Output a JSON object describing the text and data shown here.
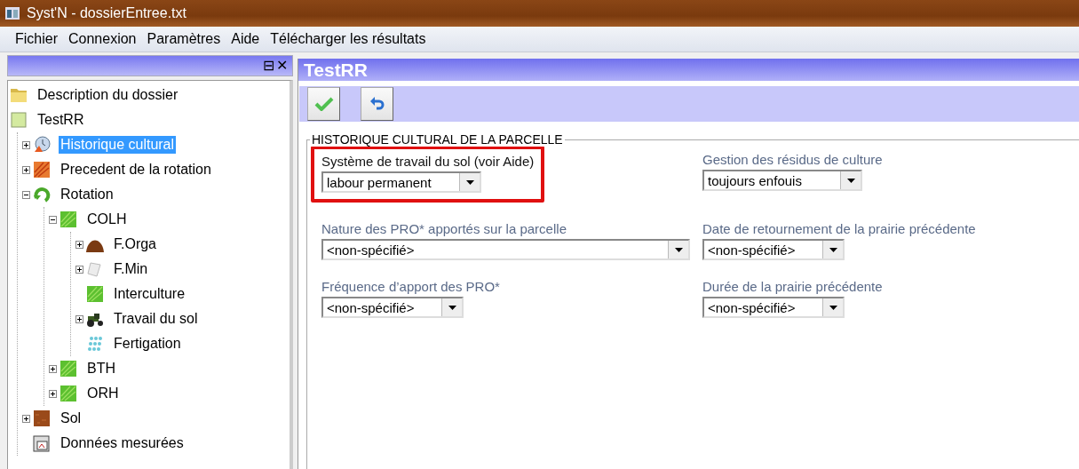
{
  "window": {
    "title": "Syst'N - dossierEntree.txt"
  },
  "menu": [
    "Fichier",
    "Connexion",
    "Paramètres",
    "Aide",
    "Télécharger les résultats"
  ],
  "tree_panel": {
    "float_glyph": "⊟",
    "close_glyph": "✕",
    "items": [
      {
        "label": "Description du dossier",
        "kind": "folder",
        "selected": false
      },
      {
        "label": "TestRR",
        "kind": "page",
        "selected": false,
        "children": [
          {
            "label": "Historique cultural",
            "kind": "clock",
            "expanded": false,
            "selected": true
          },
          {
            "label": "Precedent de la rotation",
            "kind": "autumn",
            "expanded": false,
            "selected": false
          },
          {
            "label": "Rotation",
            "kind": "rotation",
            "expanded": true,
            "selected": false,
            "children": [
              {
                "label": "COLH",
                "kind": "crop",
                "expanded": true,
                "selected": false,
                "children": [
                  {
                    "label": "F.Orga",
                    "kind": "manure",
                    "expanded": false,
                    "selected": false
                  },
                  {
                    "label": "F.Min",
                    "kind": "bag",
                    "expanded": false,
                    "selected": false
                  },
                  {
                    "label": "Interculture",
                    "kind": "crop",
                    "selected": false
                  },
                  {
                    "label": "Travail du sol",
                    "kind": "tractor",
                    "expanded": false,
                    "selected": false
                  },
                  {
                    "label": "Fertigation",
                    "kind": "drops",
                    "selected": false
                  }
                ]
              },
              {
                "label": "BTH",
                "kind": "crop",
                "expanded": false,
                "selected": false
              },
              {
                "label": "ORH",
                "kind": "crop",
                "expanded": false,
                "selected": false
              }
            ]
          },
          {
            "label": "Sol",
            "kind": "soil",
            "expanded": false,
            "selected": false
          },
          {
            "label": "Données mesurées",
            "kind": "meter",
            "selected": false
          }
        ]
      }
    ]
  },
  "editor": {
    "title": "TestRR",
    "toolbar": [
      {
        "kind": "validate"
      },
      {
        "kind": "undo"
      }
    ],
    "group_title": "HISTORIQUE CULTURAL DE LA PARCELLE",
    "fields": [
      {
        "label": "Système de travail du sol (voir Aide)",
        "value": "labour permanent",
        "highlighted": true
      },
      {
        "label": "Gestion des résidus de culture",
        "value": "toujours enfouis",
        "highlighted": false
      },
      {
        "label": "Nature des PRO* apportés sur la parcelle",
        "value": "<non-spécifié>",
        "highlighted": false
      },
      {
        "label": "Date de retournement de la prairie précédente",
        "value": "<non-spécifié>",
        "highlighted": false
      },
      {
        "label": "Fréquence d’apport des PRO*",
        "value": "<non-spécifié>",
        "highlighted": false
      },
      {
        "label": "Durée de la prairie précédente",
        "value": "<non-spécifié>",
        "highlighted": false
      }
    ]
  }
}
